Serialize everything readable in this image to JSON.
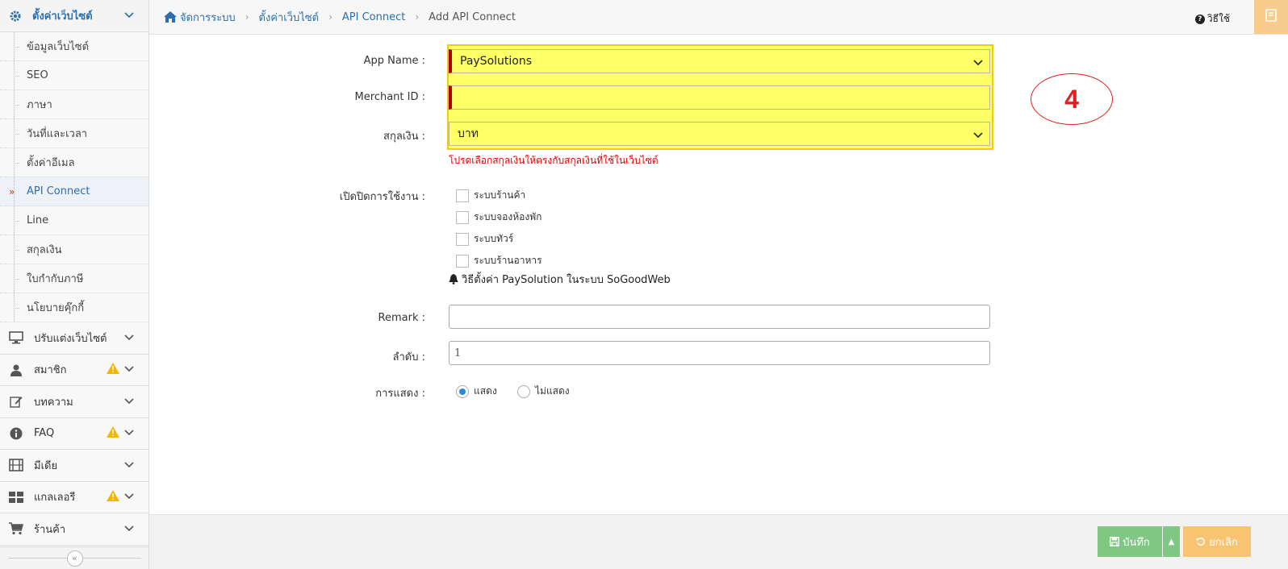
{
  "sidebar": {
    "header": "ตั้งค่าเว็บไซต์",
    "sub_items": [
      "ข้อมูลเว็บไซต์",
      "SEO",
      "ภาษา",
      "วันที่และเวลา",
      "ตั้งค่าอีเมล",
      "API Connect",
      "Line",
      "สกุลเงิน",
      "ใบกำกับภาษี",
      "นโยบายคุ๊กกี้"
    ],
    "active_sub_item": "API Connect",
    "main_items": [
      "ปรับแต่งเว็บไซต์",
      "สมาชิก",
      "บทความ",
      "FAQ",
      "มีเดีย",
      "แกลเลอรี",
      "ร้านค้า"
    ]
  },
  "breadcrumb": [
    "จัดการระบบ",
    "ตั้งค่าเว็บไซต์",
    "API Connect",
    "Add API Connect"
  ],
  "header": {
    "help_label": "วิธีใช้"
  },
  "form": {
    "app_name_label": "App Name :",
    "app_name_value": "PaySolutions",
    "merchant_id_label": "Merchant ID :",
    "merchant_id_value": "",
    "currency_label": "สกุลเงิน :",
    "currency_value": "บาท",
    "currency_error": "โปรดเลือกสกุลเงินให้ตรงกับสกุลเงินที่ใช้ในเว็บไซต์",
    "enable_label": "เปิดปิดการใช้งาน :",
    "enable_options": [
      "ระบบร้านค้า",
      "ระบบจองห้องพัก",
      "ระบบทัวร์",
      "ระบบร้านอาหาร"
    ],
    "note": "วิธีตั้งค่า PaySolution ในระบบ SoGoodWeb",
    "remark_label": "Remark :",
    "remark_value": "",
    "order_label": "ลำดับ :",
    "order_value": "1",
    "display_label": "การแสดง :",
    "display_options": [
      "แสดง",
      "ไม่แสดง"
    ],
    "display_selected": "แสดง"
  },
  "annotation": {
    "number": "4",
    "color": "#e02020"
  },
  "buttons": {
    "save": "บันทึก",
    "cancel": "ยกเลิก"
  },
  "colors": {
    "accent": "#2a6fb0",
    "highlight": "#ffff66",
    "error": "#e00000",
    "save": "#81c784",
    "cancel": "#f8c471"
  }
}
